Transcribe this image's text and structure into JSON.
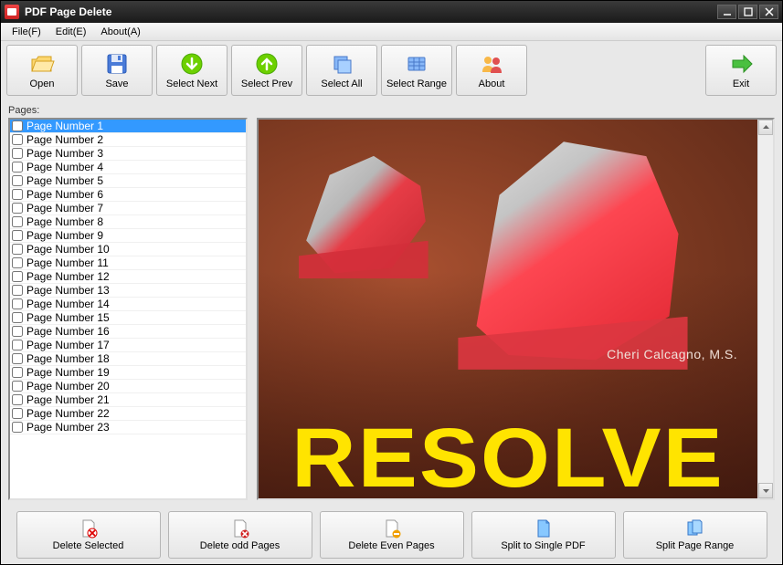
{
  "title": "PDF Page Delete",
  "menu": {
    "file": "File(F)",
    "edit": "Edit(E)",
    "about": "About(A)"
  },
  "toolbar": {
    "open": "Open",
    "save": "Save",
    "select_next": "Select Next",
    "select_prev": "Select Prev",
    "select_all": "Select All",
    "select_range": "Select Range",
    "about": "About",
    "exit": "Exit"
  },
  "pages_label": "Pages:",
  "pages": [
    "Page Number 1",
    "Page Number 2",
    "Page Number 3",
    "Page Number 4",
    "Page Number 5",
    "Page Number 6",
    "Page Number 7",
    "Page Number 8",
    "Page Number 9",
    "Page Number 10",
    "Page Number 11",
    "Page Number 12",
    "Page Number 13",
    "Page Number 14",
    "Page Number 15",
    "Page Number 16",
    "Page Number 17",
    "Page Number 18",
    "Page Number 19",
    "Page Number 20",
    "Page Number 21",
    "Page Number 22",
    "Page Number 23"
  ],
  "selected_index": 0,
  "preview": {
    "author": "Cheri Calcagno, M.S.",
    "title_word": "RESOLVE"
  },
  "bottom": {
    "delete_selected": "Delete Selected",
    "delete_odd": "Delete odd Pages",
    "delete_even": "Delete Even Pages",
    "split_single": "Split to Single PDF",
    "split_range": "Split Page Range"
  }
}
